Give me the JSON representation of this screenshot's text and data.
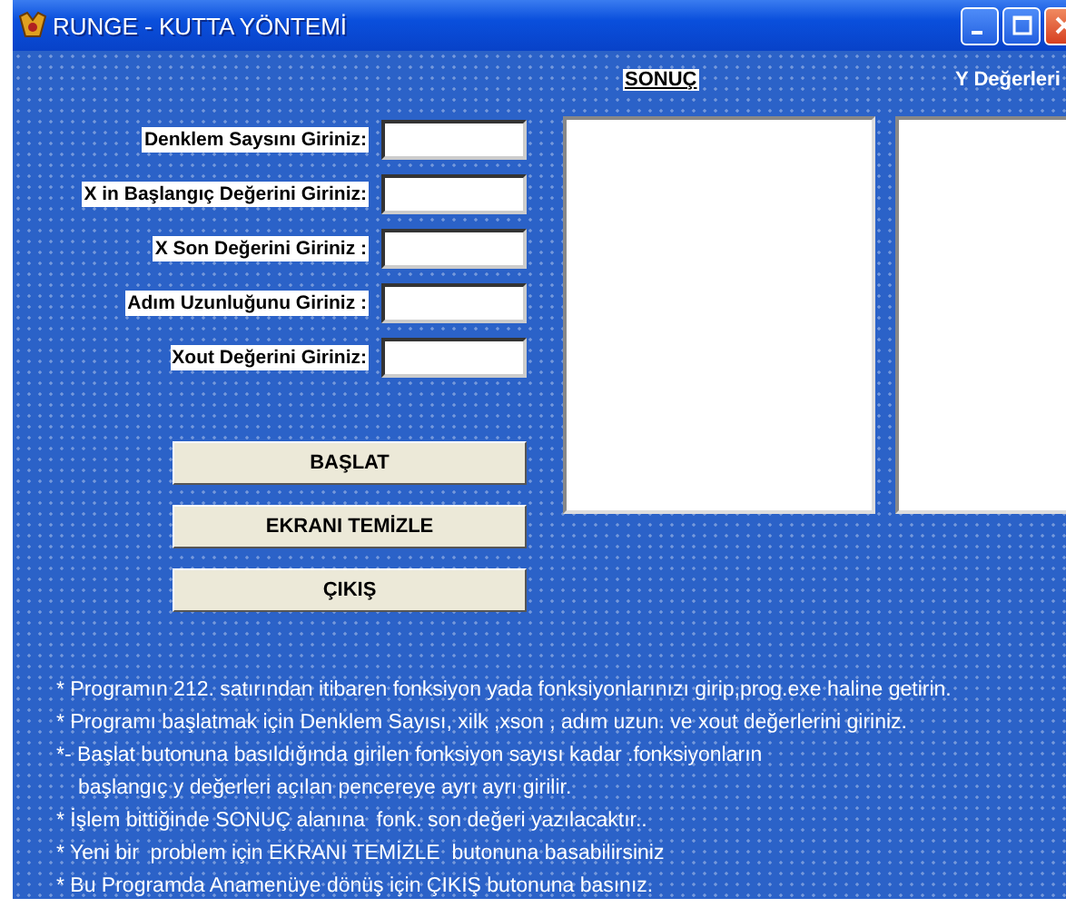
{
  "window": {
    "title": "RUNGE - KUTTA YÖNTEMİ"
  },
  "fields": [
    {
      "label": "Denklem Saysını Giriniz:"
    },
    {
      "label": "X in Başlangıç Değerini Giriniz:"
    },
    {
      "label": "X Son Değerini Giriniz :"
    },
    {
      "label": "Adım Uzunluğunu Giriniz :"
    },
    {
      "label": "Xout Değerini Giriniz:"
    }
  ],
  "buttons": [
    "BAŞLAT",
    "EKRANI TEMİZLE",
    "ÇIKIŞ"
  ],
  "panels": [
    {
      "label": "SONUÇ",
      "kind": "boxed"
    },
    {
      "label": "Y Değerleri",
      "kind": "plain"
    }
  ],
  "notes": [
    {
      "text": "* Programın 212. satırından itibaren fonksiyon yada fonksiyonlarınızı girip,prog.exe haline getirin.",
      "kind": "bullet"
    },
    {
      "text": "* Programı başlatmak için Denklem Sayısı, xilk ,xson , adım uzun. ve xout değerlerini giriniz.",
      "kind": "bullet"
    },
    {
      "text": "*- Başlat butonuna basıldığında girilen fonksiyon sayısı kadar .fonksiyonların",
      "kind": "bullet"
    },
    {
      "text": "başlangıç y değerleri açılan pencereye ayrı ayrı girilir.",
      "kind": "continuation"
    },
    {
      "text": "* İşlem bittiğinde SONUÇ alanına  fonk. son değeri yazılacaktır..",
      "kind": "bullet"
    },
    {
      "text": "* Yeni bir  problem için EKRANI TEMİZLE  butonuna basabilirsiniz",
      "kind": "bullet"
    },
    {
      "text": "* Bu Programda Anamenüye dönüş için ÇIKIŞ butonuna basınız.",
      "kind": "bullet"
    }
  ]
}
